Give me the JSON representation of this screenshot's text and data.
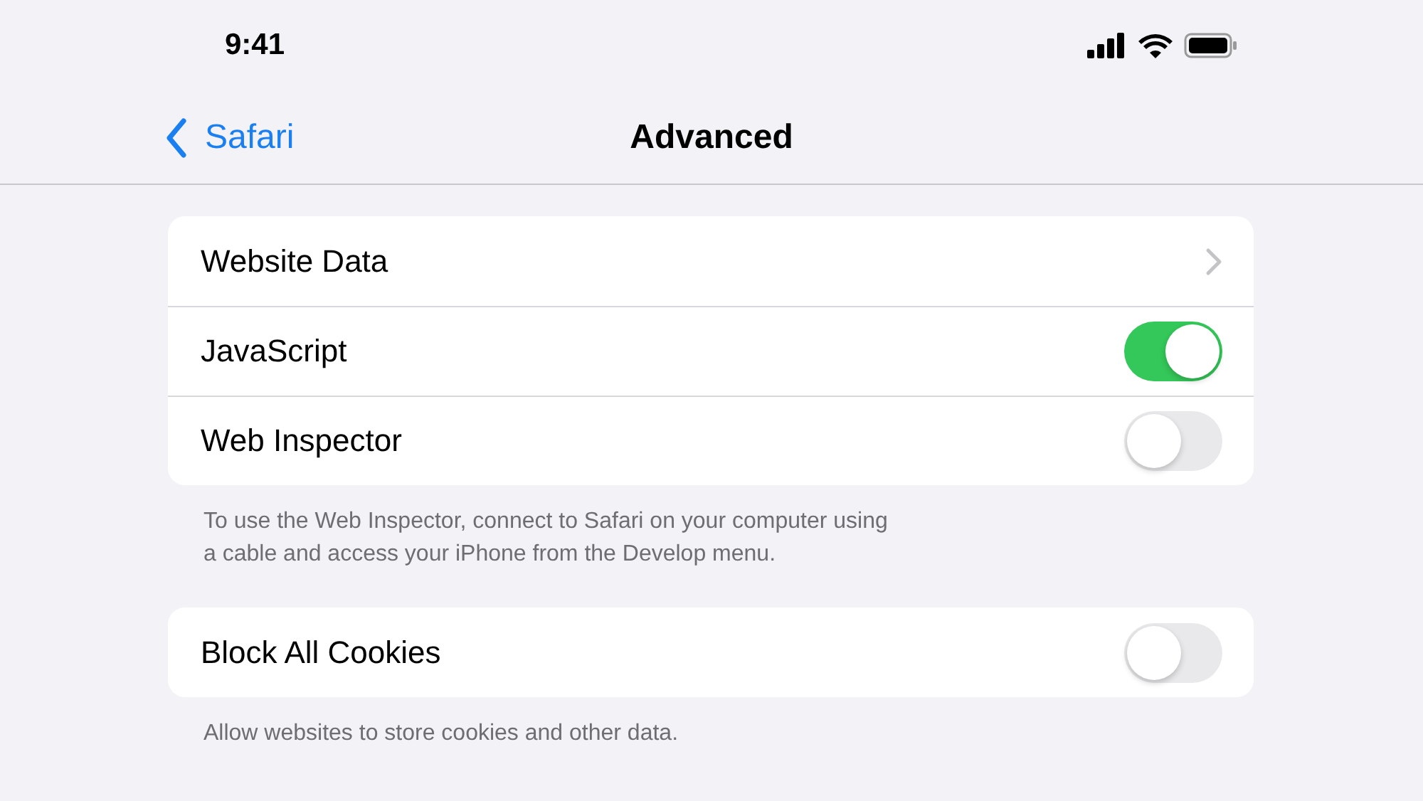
{
  "status_bar": {
    "time": "9:41"
  },
  "nav": {
    "back": "Safari",
    "title": "Advanced"
  },
  "sections": [
    {
      "rows": [
        {
          "kind": "link",
          "label": "Website Data"
        },
        {
          "kind": "toggle",
          "label": "JavaScript",
          "on": true
        },
        {
          "kind": "toggle",
          "label": "Web Inspector",
          "on": false
        }
      ],
      "footer": "To use the Web Inspector, connect to Safari on your computer using a cable and access your iPhone from the Develop menu."
    },
    {
      "rows": [
        {
          "kind": "toggle",
          "label": "Block All Cookies",
          "on": false
        }
      ],
      "footer": "Allow websites to store cookies and other data."
    }
  ]
}
